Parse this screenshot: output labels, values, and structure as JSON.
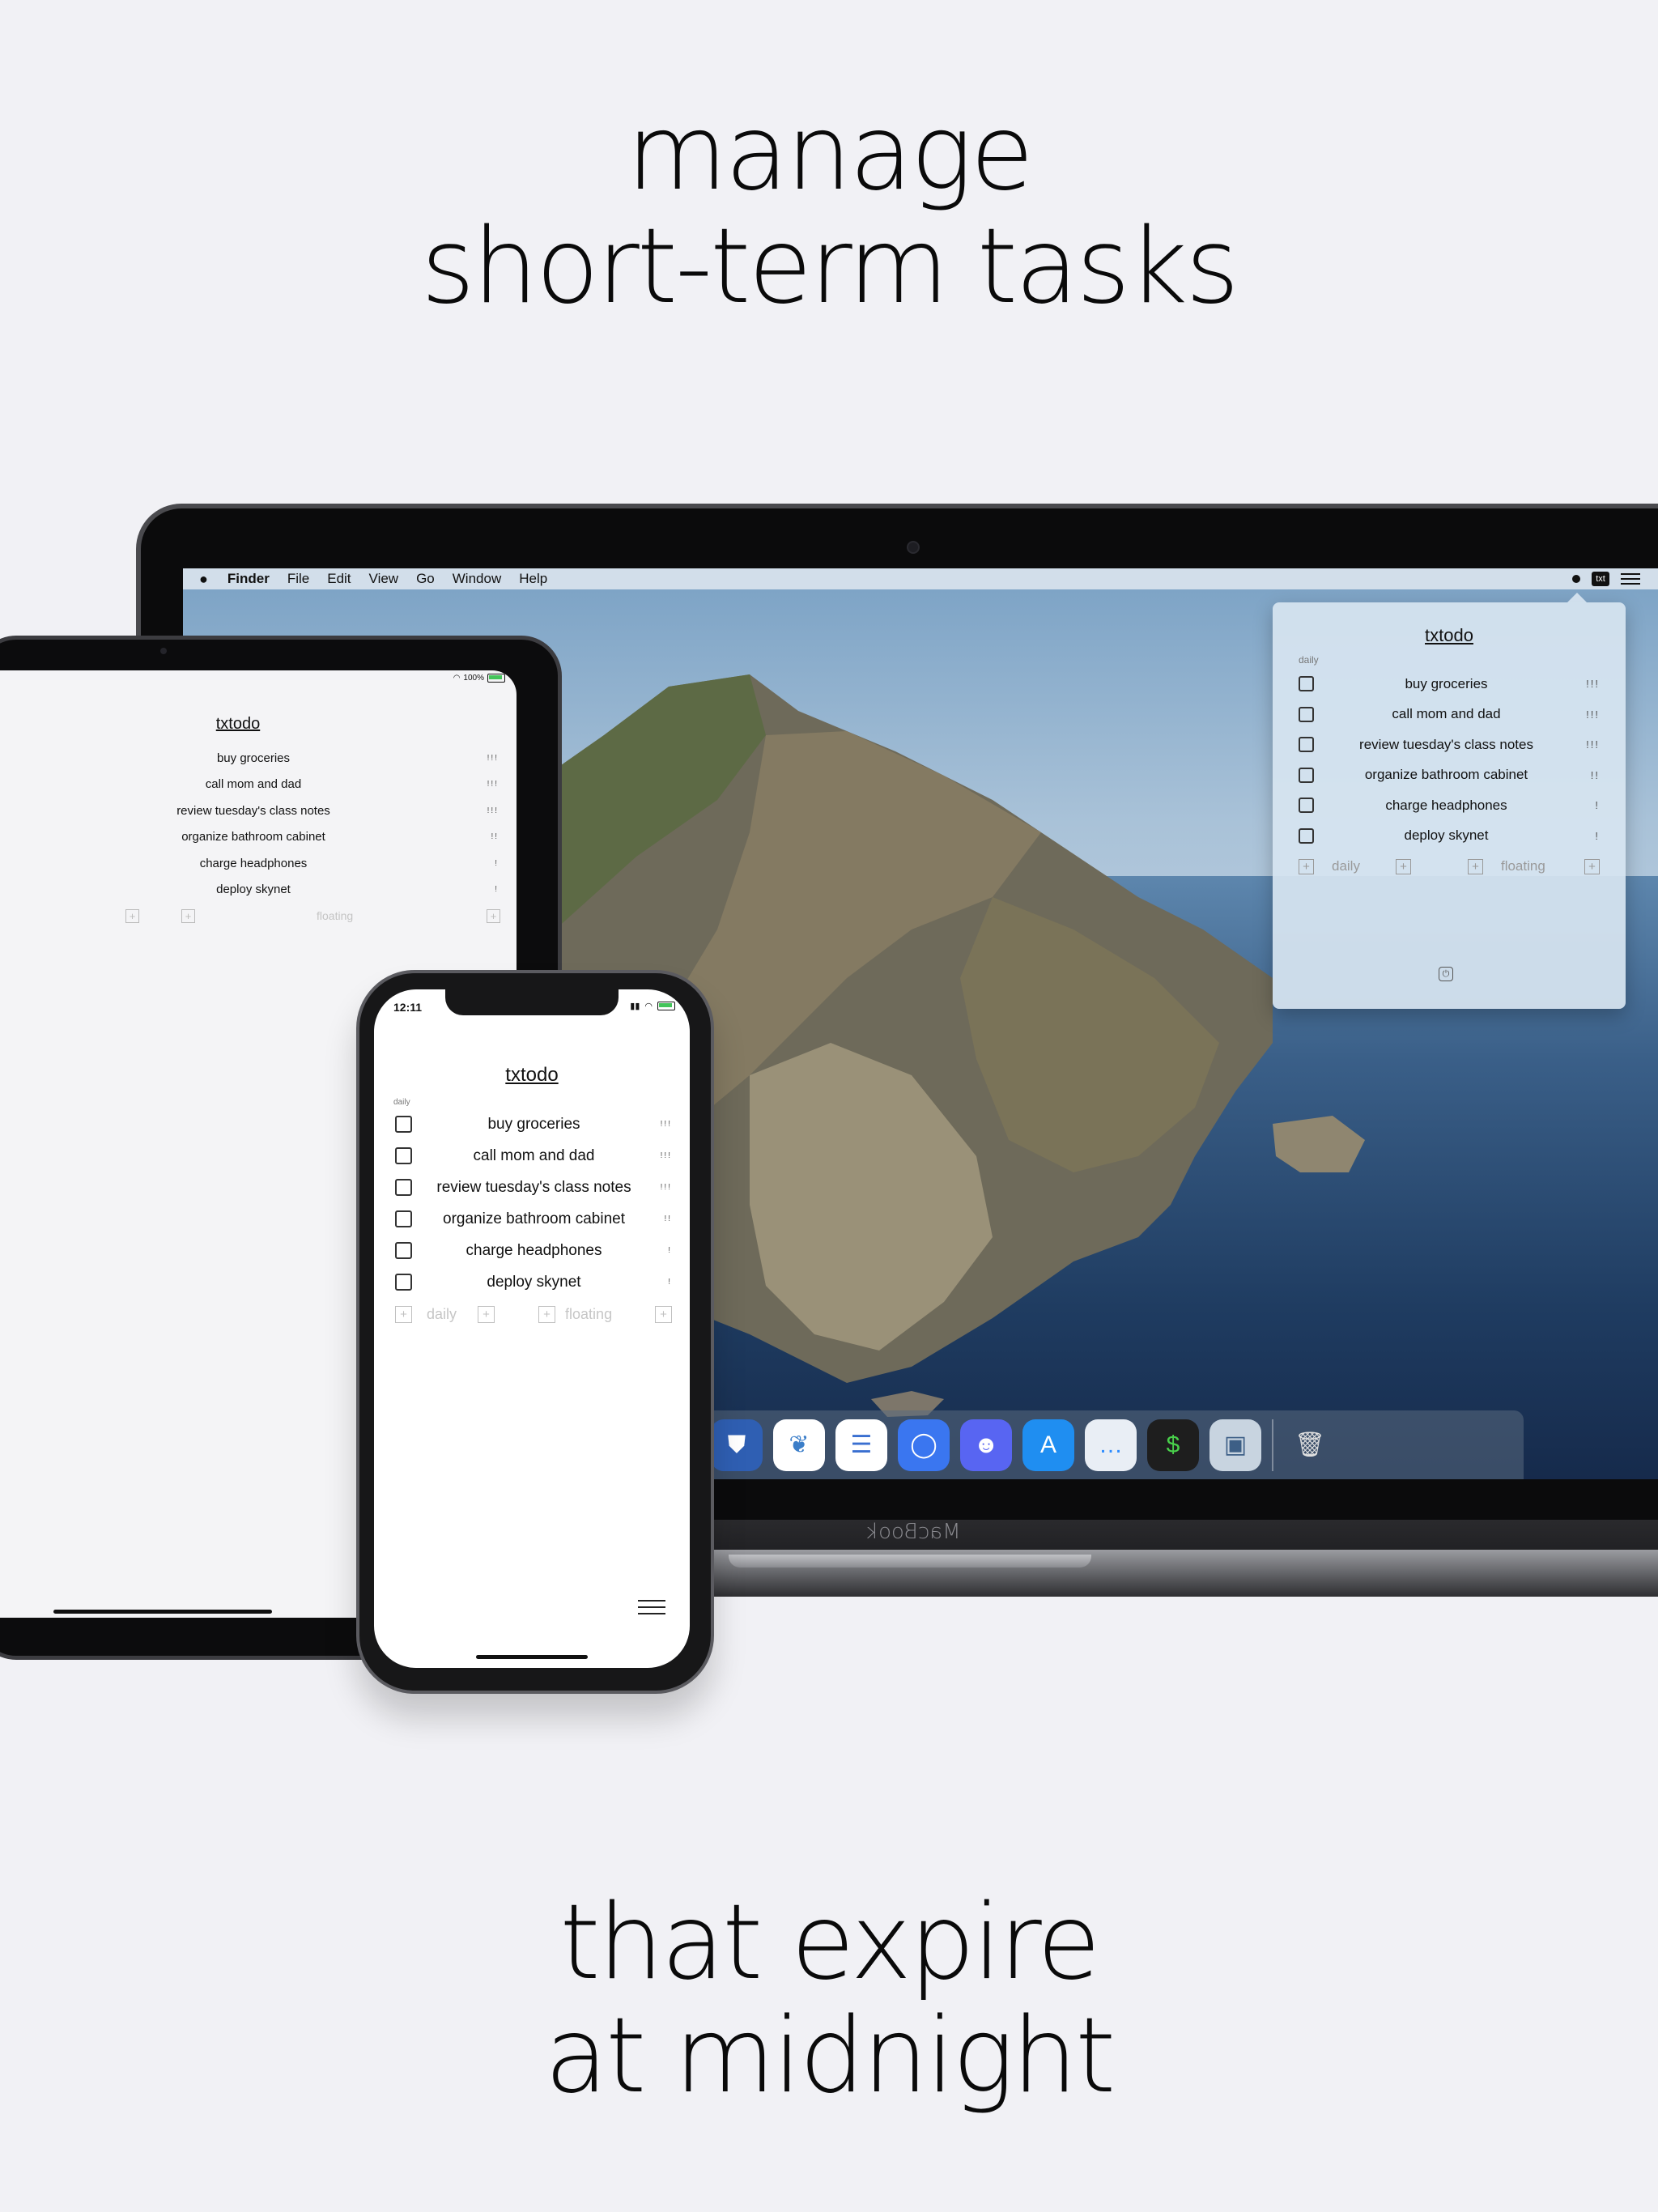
{
  "headline_top": [
    "manage",
    "short-term tasks"
  ],
  "headline_bottom": [
    "that expire",
    "at midnight"
  ],
  "app": {
    "title": "txtodo",
    "section_label": "daily",
    "tasks": [
      {
        "label": "buy groceries",
        "priority": "!!!"
      },
      {
        "label": "call mom and dad",
        "priority": "!!!"
      },
      {
        "label": "review tuesday's class notes",
        "priority": "!!!"
      },
      {
        "label": "organize bathroom cabinet",
        "priority": "!!"
      },
      {
        "label": "charge headphones",
        "priority": "!"
      },
      {
        "label": "deploy skynet",
        "priority": "!"
      }
    ],
    "add_daily_label": "daily",
    "add_floating_label": "floating",
    "plus_glyph": "+"
  },
  "macbook": {
    "brand": "MacBook",
    "menubar": {
      "apple_icon": "apple-icon",
      "items": [
        "Finder",
        "File",
        "Edit",
        "View",
        "Go",
        "Window",
        "Help"
      ],
      "status_txt": "txt"
    },
    "dock": [
      {
        "name": "bitwarden-icon",
        "glyph": "⛊",
        "color": "#2f5fb3"
      },
      {
        "name": "coral-app-icon",
        "glyph": "❦",
        "color": "#ffffff",
        "fg": "#3b7ec9"
      },
      {
        "name": "notes-doc-icon",
        "glyph": "☰",
        "color": "#ffffff",
        "fg": "#3a6fd0"
      },
      {
        "name": "signal-icon",
        "glyph": "◯",
        "color": "#3a76f0"
      },
      {
        "name": "discord-icon",
        "glyph": "☻",
        "color": "#5865f2"
      },
      {
        "name": "app-store-icon",
        "glyph": "A",
        "color": "#1f8ef1"
      },
      {
        "name": "messages-icon",
        "glyph": "…",
        "color": "#e9eef5",
        "fg": "#2d8cff"
      },
      {
        "name": "terminal-icon",
        "glyph": "$",
        "color": "#1e1e1e",
        "fg": "#49d04b"
      },
      {
        "name": "preview-icon",
        "glyph": "▣",
        "color": "#c8d4e0",
        "fg": "#3d5f86"
      },
      {
        "name": "trash-icon",
        "glyph": "🗑",
        "color": "transparent",
        "fg": "#e0e0e0"
      }
    ]
  },
  "ipad": {
    "battery": "100%"
  },
  "iphone": {
    "time": "12:11",
    "status": "wifi battery"
  }
}
